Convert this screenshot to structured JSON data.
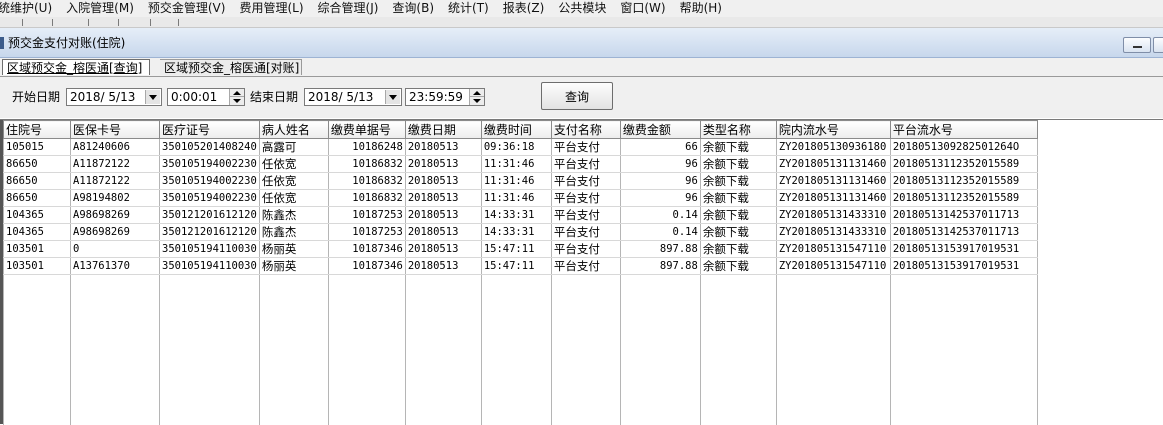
{
  "menu": [
    "统维护(U)",
    "入院管理(M)",
    "预交金管理(V)",
    "费用管理(L)",
    "综合管理(J)",
    "查询(B)",
    "统计(T)",
    "报表(Z)",
    "公共模块",
    "窗口(W)",
    "帮助(H)"
  ],
  "window": {
    "title": "预交金支付对账(住院)"
  },
  "tabs": [
    {
      "label": "区域预交金_榕医通[查询]",
      "active": true
    },
    {
      "label": "区域预交金_榕医通[对账]",
      "active": false
    }
  ],
  "filter": {
    "start_label": "开始日期",
    "start_date": "2018/ 5/13",
    "start_time": "0:00:01",
    "end_label": "结束日期",
    "end_date": "2018/ 5/13",
    "end_time": "23:59:59",
    "query_button": "查询"
  },
  "table": {
    "columns": [
      "住院号",
      "医保卡号",
      "医疗证号",
      "病人姓名",
      "缴费单据号",
      "缴费日期",
      "缴费时间",
      "支付名称",
      "缴费金额",
      "类型名称",
      "院内流水号",
      "平台流水号"
    ],
    "rows": [
      [
        "105015",
        "A81240606",
        "350105201408240",
        "高露可",
        "10186248",
        "20180513",
        "09:36:18",
        "平台支付",
        "66",
        "余额下载",
        "ZY201805130936180",
        "2018051309282501264O"
      ],
      [
        "86650",
        "A11872122",
        "350105194002230",
        "任依宽",
        "10186832",
        "20180513",
        "11:31:46",
        "平台支付",
        "96",
        "余额下载",
        "ZY201805131131460",
        "20180513112352015589"
      ],
      [
        "86650",
        "A11872122",
        "350105194002230",
        "任依宽",
        "10186832",
        "20180513",
        "11:31:46",
        "平台支付",
        "96",
        "余额下载",
        "ZY201805131131460",
        "20180513112352015589"
      ],
      [
        "86650",
        "A98194802",
        "350105194002230",
        "任依宽",
        "10186832",
        "20180513",
        "11:31:46",
        "平台支付",
        "96",
        "余额下载",
        "ZY201805131131460",
        "20180513112352015589"
      ],
      [
        "104365",
        "A98698269",
        "350121201612120",
        "陈鑫杰",
        "10187253",
        "20180513",
        "14:33:31",
        "平台支付",
        "0.14",
        "余额下载",
        "ZY201805131433310",
        "20180513142537011713"
      ],
      [
        "104365",
        "A98698269",
        "350121201612120",
        "陈鑫杰",
        "10187253",
        "20180513",
        "14:33:31",
        "平台支付",
        "0.14",
        "余额下载",
        "ZY201805131433310",
        "20180513142537011713"
      ],
      [
        "103501",
        "0",
        "350105194110030",
        "杨丽英",
        "10187346",
        "20180513",
        "15:47:11",
        "平台支付",
        "897.88",
        "余额下载",
        "ZY201805131547110",
        "20180513153917019531"
      ],
      [
        "103501",
        "A13761370",
        "350105194110030",
        "杨丽英",
        "10187346",
        "20180513",
        "15:47:11",
        "平台支付",
        "897.88",
        "余额下载",
        "ZY201805131547110",
        "20180513153917019531"
      ]
    ]
  }
}
